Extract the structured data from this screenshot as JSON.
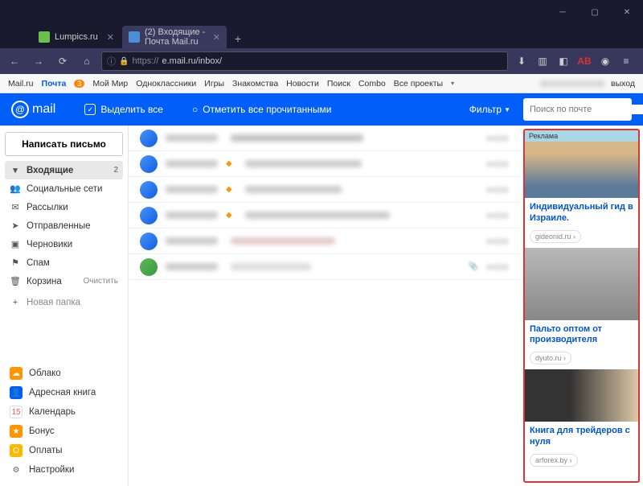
{
  "window": {
    "tabs": [
      {
        "title": "Lumpics.ru",
        "active": false
      },
      {
        "title": "(2) Входящие - Почта Mail.ru",
        "active": true
      }
    ],
    "url_prefix": "https://",
    "url": "e.mail.ru/inbox/"
  },
  "portal": {
    "links": [
      "Mail.ru",
      "Почта",
      "Мой Мир",
      "Одноклассники",
      "Игры",
      "Знакомства",
      "Новости",
      "Поиск",
      "Combo",
      "Все проекты"
    ],
    "badge": "3",
    "logout": "выход"
  },
  "header": {
    "logo": "mail",
    "select_all": "Выделить все",
    "mark_read": "Отметить все прочитанными",
    "filter": "Фильтр",
    "search_placeholder": "Поиск по почте"
  },
  "sidebar": {
    "compose": "Написать письмо",
    "folders": [
      {
        "icon": "▾",
        "label": "Входящие",
        "count": "2",
        "active": true
      },
      {
        "icon": "👥",
        "label": "Социальные сети"
      },
      {
        "icon": "✉",
        "label": "Рассылки"
      },
      {
        "icon": "➤",
        "label": "Отправленные"
      },
      {
        "icon": "▣",
        "label": "Черновики"
      },
      {
        "icon": "⚑",
        "label": "Спам"
      },
      {
        "icon": "🗑",
        "label": "Корзина",
        "action": "Очистить"
      }
    ],
    "new_folder": "Новая папка",
    "services": [
      {
        "label": "Облако",
        "color": "#ff9500"
      },
      {
        "label": "Адресная книга",
        "color": "#005ff9"
      },
      {
        "label": "Календарь",
        "color": "#fff",
        "fg": "#f55"
      },
      {
        "label": "Бонус",
        "color": "#ff9500"
      },
      {
        "label": "Оплаты",
        "color": "#ffb700"
      },
      {
        "label": "Настройки",
        "color": "transparent",
        "fg": "#666"
      }
    ]
  },
  "ads": {
    "label": "Реклама",
    "items": [
      {
        "title": "Индивидуальный гид в Израиле.",
        "source": "gideonid.ru ›"
      },
      {
        "title": "Пальто оптом от производителя",
        "source": "dyuto.ru ›"
      },
      {
        "title": "Книга для трейдеров с нуля",
        "source": "arforex.by ›"
      }
    ]
  }
}
